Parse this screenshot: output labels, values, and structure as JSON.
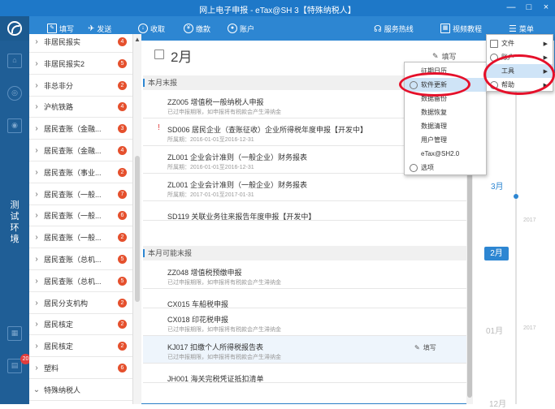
{
  "app": {
    "title": "网上电子申报 - eTax@SH 3【特殊纳税人】",
    "window_controls": [
      "—",
      "□",
      "×"
    ]
  },
  "toolbar": {
    "fill": "填写",
    "send": "发送",
    "receive": "收取",
    "pay": "缴款",
    "account": "账户",
    "hotline": "服务热线",
    "video": "视频教程",
    "menu": "菜单"
  },
  "rail": {
    "test_env": [
      "测",
      "试",
      "环",
      "境"
    ],
    "badge": "20"
  },
  "sidebar": {
    "items": [
      {
        "label": "非居民报实",
        "badge": "4"
      },
      {
        "label": "非居民报实2",
        "badge": "5"
      },
      {
        "label": "非总非分",
        "badge": "2"
      },
      {
        "label": "沪杭铁路",
        "badge": "4"
      },
      {
        "label": "居民查账（金融...",
        "badge": "3"
      },
      {
        "label": "居民查账（金融...",
        "badge": "4"
      },
      {
        "label": "居民查账（事业...",
        "badge": "2"
      },
      {
        "label": "居民查账（一般...",
        "badge": "7"
      },
      {
        "label": "居民查账（一般...",
        "badge": "6"
      },
      {
        "label": "居民查账（一般...",
        "badge": "2"
      },
      {
        "label": "居民查账（总机...",
        "badge": "5"
      },
      {
        "label": "居民查账（总机...",
        "badge": "5"
      },
      {
        "label": "居民分支机构",
        "badge": "2"
      },
      {
        "label": "居民核定",
        "badge": "2"
      },
      {
        "label": "居民核定",
        "badge": "2"
      },
      {
        "label": "塑料",
        "badge": "6"
      },
      {
        "label": "特殊纳税人",
        "badge": ""
      }
    ]
  },
  "main": {
    "month": "2月",
    "fill_btn": "填写",
    "sections": {
      "due": "本月末报",
      "optional": "本月可能末报"
    },
    "rows_due": [
      {
        "title": "ZZ005 增值税一般纳税人申报",
        "sub": "已过申报期限，如申报将有税款会产生滞纳金",
        "mark": ""
      },
      {
        "title": "SD006 居民企业（查账征收）企业所得税年度申报【开发中】",
        "sub": "所属期：2016-01-01至2016-12-31",
        "mark": "!"
      },
      {
        "title": "ZL001 企业会计准则（一般企业）财务报表",
        "sub": "所属期：2016-01-01至2016-12-31",
        "mark": ""
      },
      {
        "title": "ZL001 企业会计准则（一般企业）财务报表",
        "sub": "所属期：2017-01-01至2017-01-31",
        "mark": ""
      },
      {
        "title": "SD119 关联业务往来报告年度申报【开发中】",
        "sub": "",
        "mark": ""
      }
    ],
    "rows_optional": [
      {
        "title": "ZZ048 增值税预缴申报",
        "sub": "已过申报期限，如申报将有税款会产生滞纳金"
      },
      {
        "title": "CX015 车船税申报",
        "sub": ""
      },
      {
        "title": "CX018 印花税申报",
        "sub": "已过申报期限，如申报将有税款会产生滞纳金"
      },
      {
        "title": "KJ017 扣缴个人所得税报告表",
        "sub": "已过申报期限，如申报将有税款会产生滞纳金",
        "action": "填写"
      },
      {
        "title": "JH001 海关完税凭证抵扣清单",
        "sub": ""
      }
    ]
  },
  "timeline": {
    "months": [
      "3月",
      "2月",
      "01月",
      "12月"
    ],
    "years": [
      "2017",
      "2017"
    ],
    "current": "2月"
  },
  "menu_main": {
    "items": [
      {
        "label": "文件",
        "arrow": "▶"
      },
      {
        "label": "账户",
        "arrow": "▶"
      },
      {
        "label": "工具",
        "arrow": "▶"
      },
      {
        "label": "帮助",
        "arrow": "▶"
      }
    ]
  },
  "menu_tools": {
    "items": [
      {
        "label": "征期日历"
      },
      {
        "label": "软件更新"
      },
      {
        "label": "数据备份"
      },
      {
        "label": "数据恢复"
      },
      {
        "label": "数据清理"
      },
      {
        "label": "用户管理"
      },
      {
        "label": "eTax@SH2.0"
      },
      {
        "label": "选项"
      }
    ]
  },
  "colors": {
    "brand": "#2d86d2",
    "titlebar": "#1e78c8",
    "rail": "#1f5e96",
    "badge": "#e5502d",
    "highlight_ring": "#e5102a"
  }
}
